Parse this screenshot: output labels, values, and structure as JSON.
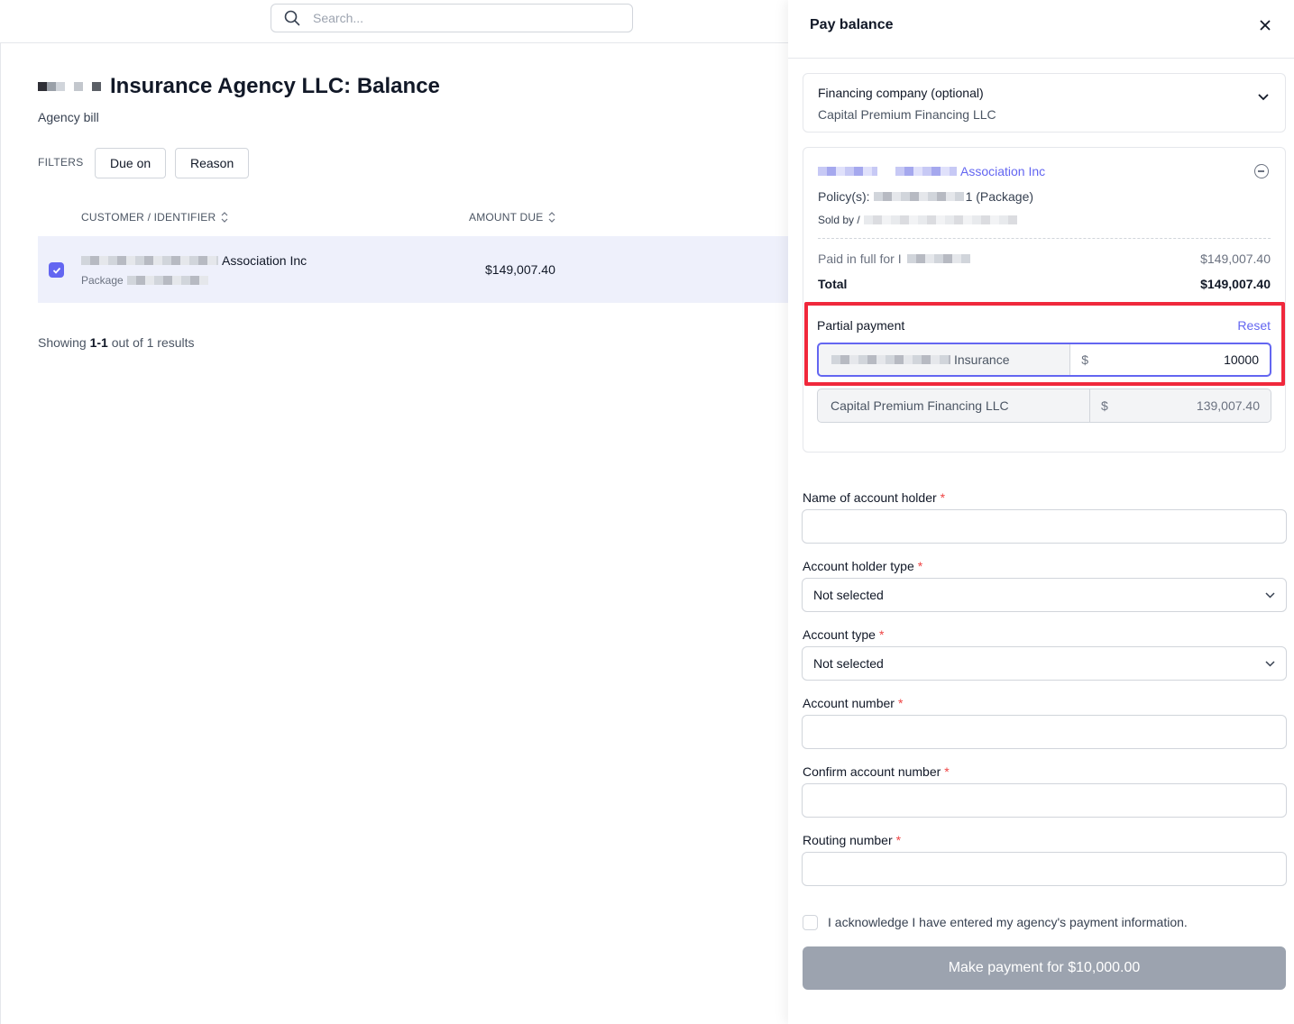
{
  "search": {
    "placeholder": "Search..."
  },
  "page": {
    "title": "Insurance Agency LLC: Balance",
    "subtitle": "Agency bill",
    "filters_label": "FILTERS",
    "filter_due_on": "Due on",
    "filter_reason": "Reason"
  },
  "table": {
    "col_customer": "CUSTOMER / IDENTIFIER",
    "col_amount": "AMOUNT DUE",
    "row": {
      "customer": "Association Inc",
      "identifier": "Package",
      "amount": "$149,007.40"
    },
    "showing_prefix": "Showing",
    "showing_range": "1-1",
    "showing_suffix": "out of 1 results"
  },
  "drawer": {
    "title": "Pay balance",
    "financing_label": "Financing company (optional)",
    "financing_value": "Capital Premium Financing LLC",
    "policy": {
      "name": "Association Inc",
      "policies_prefix": "Policy(s):",
      "policies_suffix": "1 (Package)",
      "sold_by": "Sold by /",
      "paid_label": "Paid in full for I",
      "paid_amount": "$149,007.40",
      "total_label": "Total",
      "total_amount": "$149,007.40"
    },
    "partial": {
      "label": "Partial payment",
      "reset": "Reset",
      "row1_name": "Insurance",
      "currency": "$",
      "row1_value": "10000",
      "row2_name": "Capital Premium Financing LLC",
      "row2_value": "139,007.40"
    },
    "fields": {
      "holder_name": "Name of account holder",
      "holder_type": "Account holder type",
      "holder_type_value": "Not selected",
      "account_type": "Account type",
      "account_type_value": "Not selected",
      "account_number": "Account number",
      "confirm_number": "Confirm account number",
      "routing_number": "Routing number",
      "required_mark": "*"
    },
    "ack": "I acknowledge I have entered my agency's payment information.",
    "pay_button": "Make payment for $10,000.00"
  },
  "colors": {
    "accent": "#6366f1",
    "highlight": "#f0283c",
    "disabled": "#9ca3af"
  }
}
